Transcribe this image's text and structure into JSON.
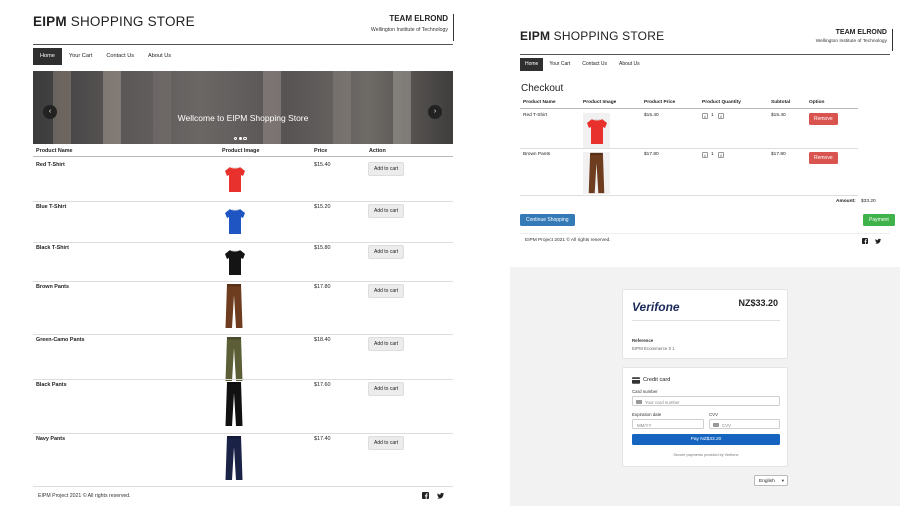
{
  "left": {
    "brand_bold": "EIPM",
    "brand_rest": " SHOPPING STORE",
    "team": "TEAM ELROND",
    "team_sub": "Wellington Institute of Technology",
    "nav": [
      "Home",
      "Your Cart",
      "Contact Us",
      "About Us"
    ],
    "carousel_title": "Wellcome to EIPM Shopping Store",
    "carousel_prev": "‹",
    "carousel_next": "›",
    "columns": [
      "Product Name",
      "Product Image",
      "Price",
      "Action"
    ],
    "products": [
      {
        "name": "Red T-Shirt",
        "price": "$15.40",
        "action": "Add to cart",
        "color": "#e8302c",
        "kind": "shirt"
      },
      {
        "name": "Blue T-Shirt",
        "price": "$15.20",
        "action": "Add to cart",
        "color": "#1f55c2",
        "kind": "shirt"
      },
      {
        "name": "Black T-Shirt",
        "price": "$15.80",
        "action": "Add to cart",
        "color": "#141414",
        "kind": "shirt"
      },
      {
        "name": "Brown Pants",
        "price": "$17.80",
        "action": "Add to cart",
        "color": "#6e3c1e",
        "kind": "pants"
      },
      {
        "name": "Green-Camo Pants",
        "price": "$18.40",
        "action": "Add to cart",
        "color": "#5b5e37",
        "kind": "pants"
      },
      {
        "name": "Black Pants",
        "price": "$17.60",
        "action": "Add to cart",
        "color": "#111111",
        "kind": "pants"
      },
      {
        "name": "Navy Pants",
        "price": "$17.40",
        "action": "Add to cart",
        "color": "#1a2246",
        "kind": "pants"
      }
    ],
    "footer": "EIPM Project 2021 © All rights reserved."
  },
  "checkout": {
    "brand_bold": "EIPM",
    "brand_rest": " SHOPPING STORE",
    "team": "TEAM ELROND",
    "team_sub": "Wellington Institute of Technology",
    "nav": [
      "Home",
      "Your Cart",
      "Contact Us",
      "About Us"
    ],
    "heading": "Checkout",
    "columns": [
      "Product Name",
      "Product Image",
      "Product Price",
      "Product Quantity",
      "Subtotal",
      "Option"
    ],
    "items": [
      {
        "name": "Red T-Shirt",
        "price": "$15.40",
        "qty": "1",
        "subtotal": "$15.40",
        "option": "Remove",
        "color": "#e8302c",
        "kind": "shirt"
      },
      {
        "name": "Brown Pants",
        "price": "$17.80",
        "qty": "1",
        "subtotal": "$17.80",
        "option": "Remove",
        "color": "#6e3c1e",
        "kind": "pants"
      }
    ],
    "qty_minus": "∧",
    "qty_plus": "∨",
    "amount_label": "Amount:",
    "amount_value": "$33.20",
    "continue_label": "Continue Shopping",
    "payment_label": "Payment",
    "footer": "EIPM Project 2021 © All rights reserved."
  },
  "verifone": {
    "logo": "Verifone",
    "amount": "NZ$33.20",
    "reference_label": "Reference",
    "reference_value": "EIPM Ecommerce 0 1",
    "credit_card_title": "Credit card",
    "card_number_label": "Card number",
    "card_number_placeholder": "Your card number",
    "expiry_label": "Expiration date",
    "expiry_placeholder": "MM/YY",
    "cvv_label": "CVV",
    "cvv_placeholder": "CVV",
    "pay_label": "Pay NZ$33.20",
    "secure_text": "Secure payments provided by Verifone",
    "language": "English"
  },
  "colors": {
    "nav_active": "#2f2f2f",
    "remove": "#d9534f",
    "continue": "#337ab7",
    "payment": "#3fb24a",
    "pay": "#1565c0",
    "verifone_brand": "#1a2a5a"
  },
  "icons": [
    "facebook-icon",
    "twitter-icon",
    "credit-card-icon",
    "card-chip-icon"
  ]
}
